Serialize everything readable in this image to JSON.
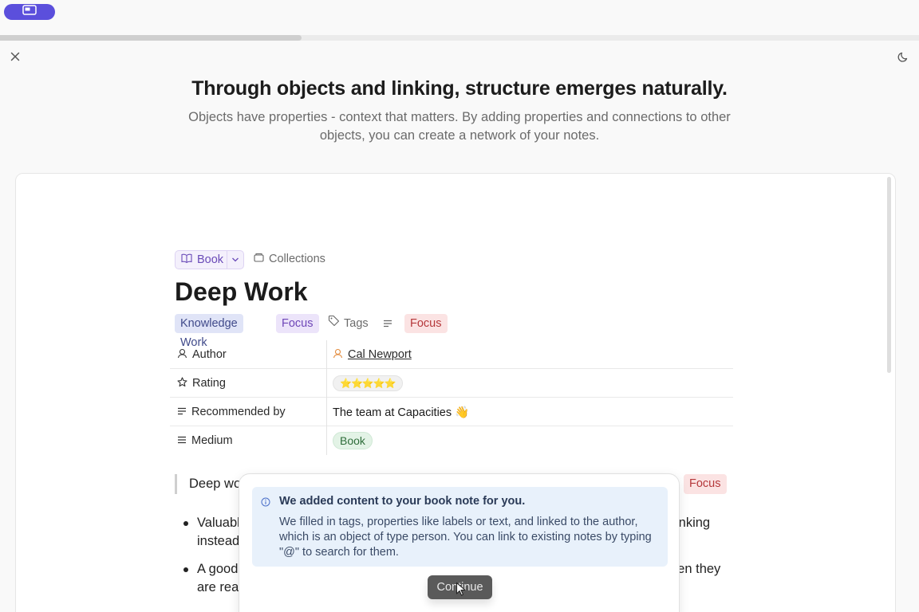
{
  "top_bar": {
    "pill_icon": "window-icon",
    "progress_fraction": 0.328
  },
  "icons": {
    "close": "close-icon",
    "theme": "moon-icon"
  },
  "heading": {
    "title": "Through objects and linking, structure emerges naturally.",
    "subtitle": "Objects have properties - context that matters. By adding properties and connections to other objects, you can create a network of your notes."
  },
  "note": {
    "type_label": "Book",
    "collections_label": "Collections",
    "title": "Deep Work",
    "tags": [
      "Knowledge Work",
      "Focus"
    ],
    "tags_label": "Tags",
    "extra_tag": "Focus",
    "properties": [
      {
        "key": "Author",
        "icon": "person-icon",
        "value": "Cal Newport"
      },
      {
        "key": "Rating",
        "icon": "star-icon",
        "value": "⭐⭐⭐⭐⭐"
      },
      {
        "key": "Recommended by",
        "icon": "lines-icon",
        "value": "The team at Capacities 👋"
      },
      {
        "key": "Medium",
        "icon": "list-icon",
        "value": "Book"
      }
    ],
    "quote_text": "Deep wo",
    "quote_tag": "Focus",
    "bullets": [
      {
        "left": "Valuabl",
        "left2": "instead",
        "right": "inking"
      },
      {
        "left": "A good",
        "left2": "are read",
        "right": "hen they"
      }
    ]
  },
  "popup": {
    "title": "We added content to your book note for you.",
    "body": "We filled in tags, properties like labels or text, and linked to the author, which is an object of type person. You can link to existing notes by typing \"@\" to search for them.",
    "button": "Continue"
  },
  "colors": {
    "accent": "#5b4fdc",
    "tag_purple": "#ece4fa",
    "tag_red": "#fbe3e3",
    "info_bg": "#e8f1fb"
  }
}
